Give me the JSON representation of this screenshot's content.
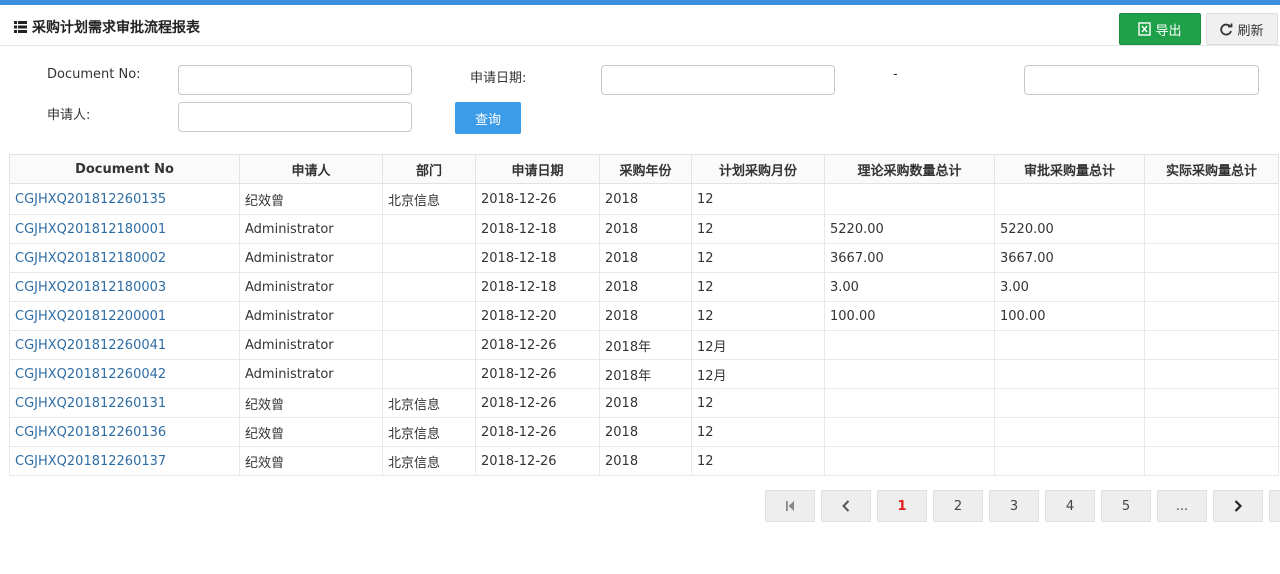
{
  "header": {
    "title": "采购计划需求审批流程报表",
    "export_label": "导出",
    "refresh_label": "刷新"
  },
  "filters": {
    "doc_no_label": "Document No:",
    "apply_date_label": "申请日期:",
    "date_separator": "-",
    "applicant_label": "申请人:",
    "query_label": "查询",
    "doc_no_value": "",
    "date_from_value": "",
    "date_to_value": "",
    "applicant_value": ""
  },
  "table": {
    "columns": [
      "Document No",
      "申请人",
      "部门",
      "申请日期",
      "采购年份",
      "计划采购月份",
      "理论采购数量总计",
      "审批采购量总计",
      "实际采购量总计"
    ],
    "rows": [
      [
        "CGJHXQ201812260135",
        "纪效曾",
        "北京信息",
        "2018-12-26",
        "2018",
        "12",
        "",
        "",
        ""
      ],
      [
        "CGJHXQ201812180001",
        "Administrator",
        "",
        "2018-12-18",
        "2018",
        "12",
        "5220.00",
        "5220.00",
        ""
      ],
      [
        "CGJHXQ201812180002",
        "Administrator",
        "",
        "2018-12-18",
        "2018",
        "12",
        "3667.00",
        "3667.00",
        ""
      ],
      [
        "CGJHXQ201812180003",
        "Administrator",
        "",
        "2018-12-18",
        "2018",
        "12",
        "3.00",
        "3.00",
        ""
      ],
      [
        "CGJHXQ201812200001",
        "Administrator",
        "",
        "2018-12-20",
        "2018",
        "12",
        "100.00",
        "100.00",
        ""
      ],
      [
        "CGJHXQ201812260041",
        "Administrator",
        "",
        "2018-12-26",
        "2018年",
        "12月",
        "",
        "",
        ""
      ],
      [
        "CGJHXQ201812260042",
        "Administrator",
        "",
        "2018-12-26",
        "2018年",
        "12月",
        "",
        "",
        ""
      ],
      [
        "CGJHXQ201812260131",
        "纪效曾",
        "北京信息",
        "2018-12-26",
        "2018",
        "12",
        "",
        "",
        ""
      ],
      [
        "CGJHXQ201812260136",
        "纪效曾",
        "北京信息",
        "2018-12-26",
        "2018",
        "12",
        "",
        "",
        ""
      ],
      [
        "CGJHXQ201812260137",
        "纪效曾",
        "北京信息",
        "2018-12-26",
        "2018",
        "12",
        "",
        "",
        ""
      ]
    ]
  },
  "pagination": {
    "pages": [
      "1",
      "2",
      "3",
      "4",
      "5",
      "..."
    ],
    "current": "1"
  }
}
